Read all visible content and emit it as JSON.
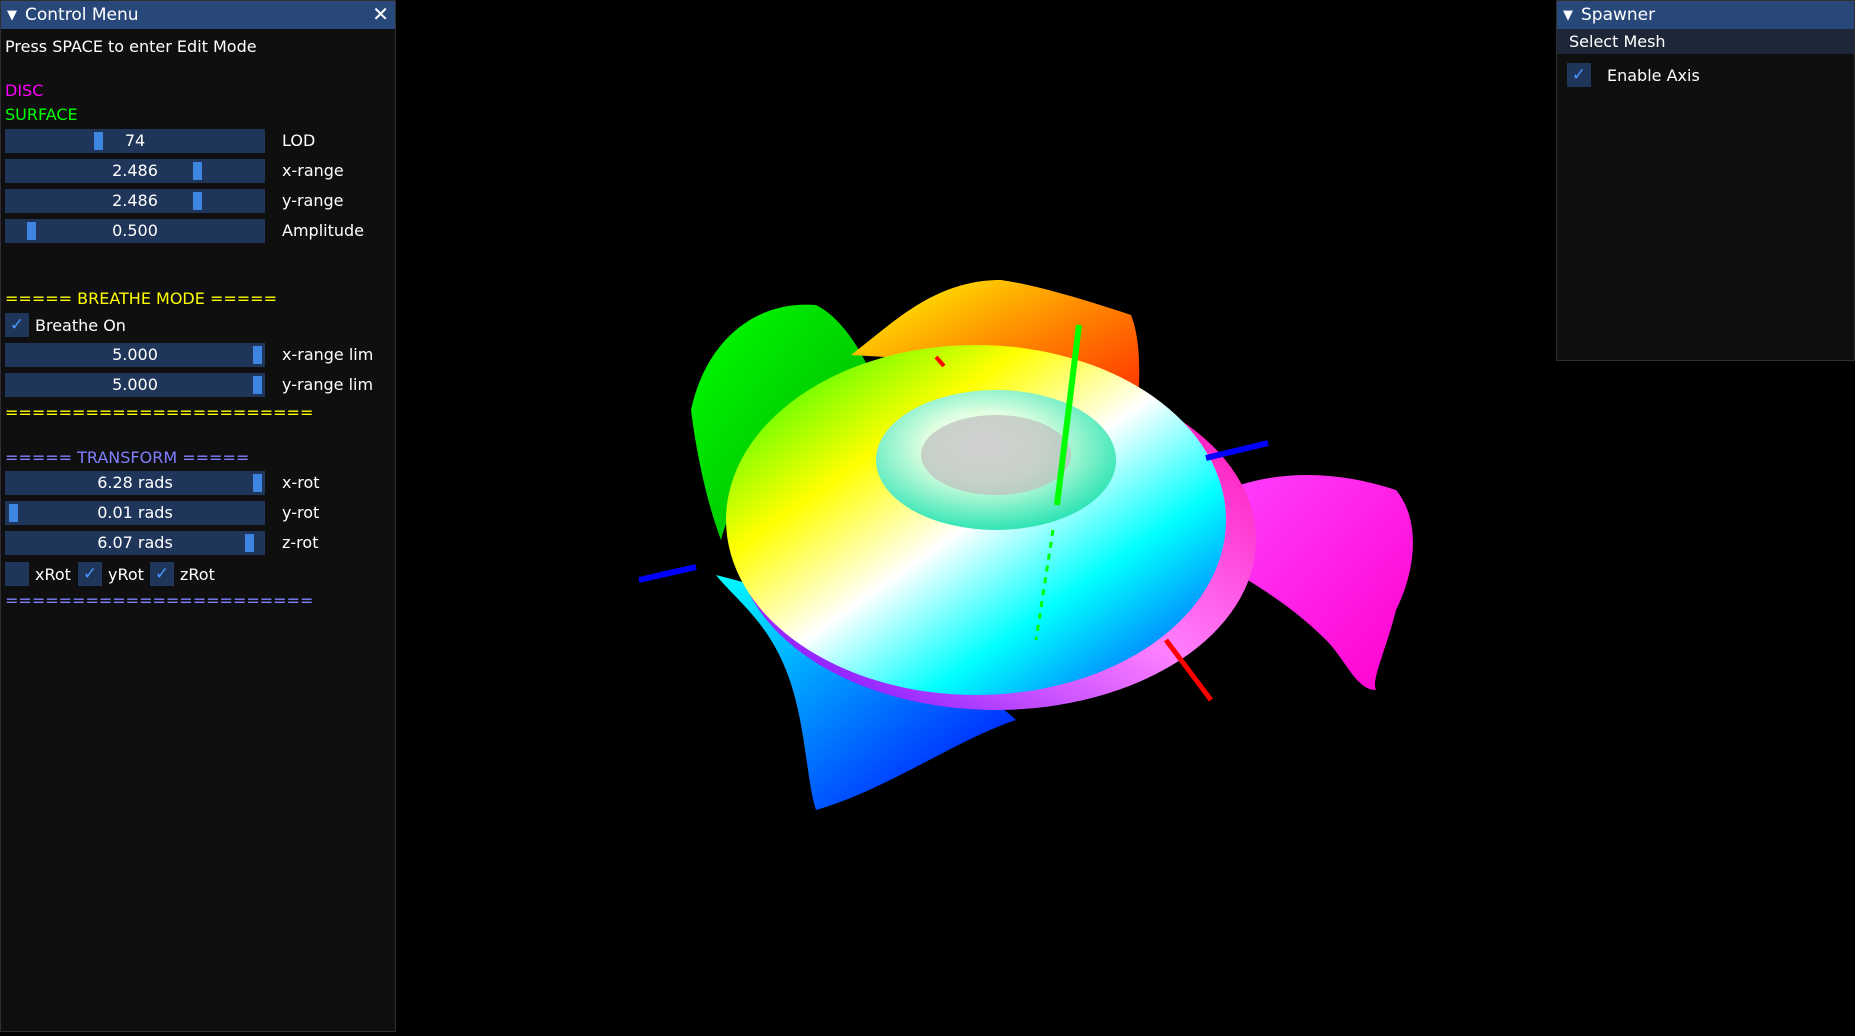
{
  "control": {
    "title": "Control Menu",
    "hint": "Press SPACE to enter Edit Mode",
    "disc_label": "DISC",
    "surface_label": "SURFACE",
    "sliders": [
      {
        "value": "74",
        "label": "LOD",
        "level": 0.36
      },
      {
        "value": "2.486",
        "label": "x-range",
        "level": 0.75
      },
      {
        "value": "2.486",
        "label": "y-range",
        "level": 0.75
      },
      {
        "value": "0.500",
        "label": "Amplitude",
        "level": 0.08
      }
    ],
    "breathe_header": "===== BREATHE MODE =====",
    "breathe_on": {
      "label": "Breathe On",
      "checked": true
    },
    "breathe_sliders": [
      {
        "value": "5.000",
        "label": "x-range lim",
        "level": 1.0
      },
      {
        "value": "5.000",
        "label": "y-range lim",
        "level": 1.0
      }
    ],
    "breathe_footer": "=======================",
    "transform_header": "===== TRANSFORM =====",
    "transform_sliders": [
      {
        "value": "6.28 rads",
        "label": "x-rot",
        "level": 1.0
      },
      {
        "value": "0.01 rads",
        "label": "y-rot",
        "level": 0.0
      },
      {
        "value": "6.07 rads",
        "label": "z-rot",
        "level": 0.97
      }
    ],
    "rot_toggles": [
      {
        "label": "xRot",
        "checked": false
      },
      {
        "label": "yRot",
        "checked": true
      },
      {
        "label": "zRot",
        "checked": true
      }
    ],
    "transform_footer": "=======================",
    "colors": {
      "disc": "#ff00ff",
      "surface": "#00ff00",
      "breathe": "#ffff00",
      "transform": "#8080ff"
    }
  },
  "spawner": {
    "title": "Spawner",
    "select_mesh": "Select Mesh",
    "enable_axis": {
      "label": "Enable Axis",
      "checked": true
    }
  },
  "icons": {
    "collapse": "triangle-down-icon",
    "close": "close-icon",
    "check": "checkmark-icon"
  }
}
